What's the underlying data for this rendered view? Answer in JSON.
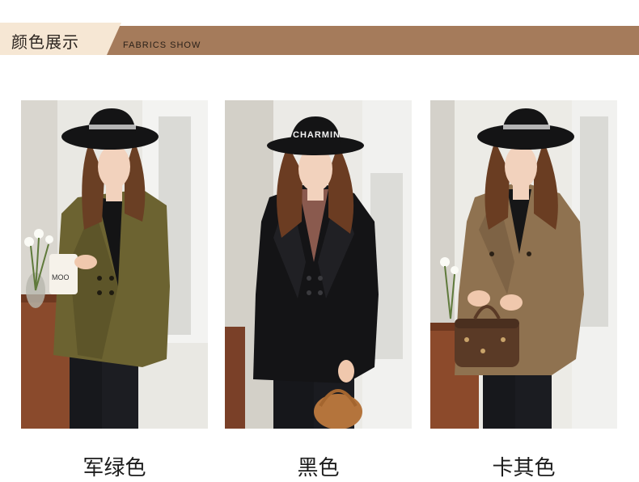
{
  "header": {
    "title": "颜色展示",
    "subtitle": "FABRICS SHOW"
  },
  "colors": [
    {
      "label": "军绿色",
      "swatch": "#6b6232"
    },
    {
      "label": "黑色",
      "swatch": "#15151a"
    },
    {
      "label": "卡其色",
      "swatch": "#8f7451"
    }
  ],
  "photo_texts": {
    "cup": "MOO",
    "hat_band": "CHARMIN"
  }
}
